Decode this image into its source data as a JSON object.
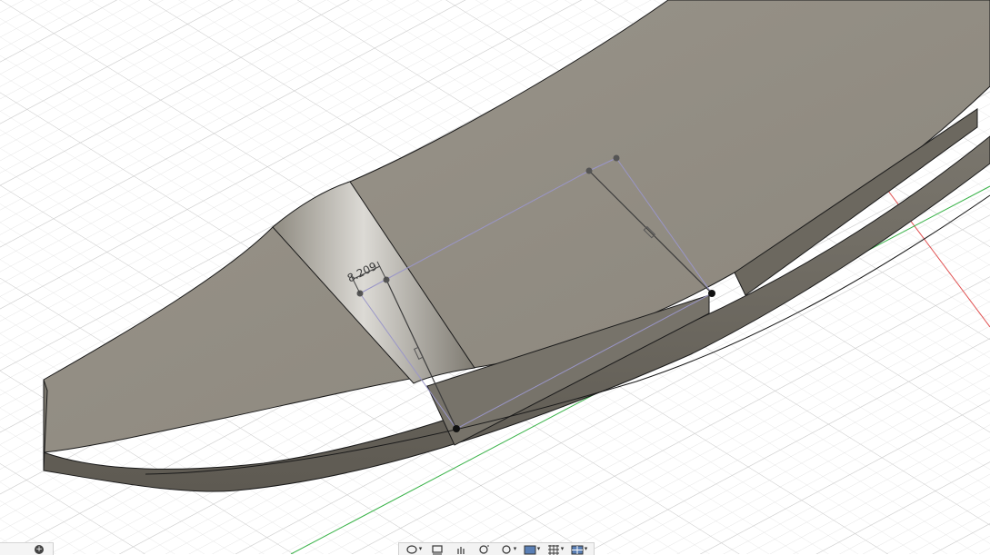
{
  "app": {
    "view": "3D model viewport"
  },
  "sketch": {
    "dimension_value": "8.209"
  },
  "toolbar": {
    "items": [
      {
        "icon": "orbit-icon",
        "has_menu": true
      },
      {
        "icon": "look-at-icon",
        "has_menu": false
      },
      {
        "icon": "pan-hand-icon",
        "has_menu": false
      },
      {
        "icon": "zoom-icon",
        "has_menu": false
      },
      {
        "icon": "fit-zoom-window-icon",
        "has_menu": true
      },
      {
        "icon": "display-settings-icon",
        "has_menu": true
      },
      {
        "icon": "grid-snap-icon",
        "has_menu": true
      },
      {
        "icon": "viewports-icon",
        "has_menu": true
      }
    ]
  },
  "colors": {
    "grid_major": "#cfcfcf",
    "grid_minor": "#e6e6e6",
    "body_top": "#8c877c",
    "body_side": "#6f6b62",
    "body_edge": "#1a1a1a",
    "axis_x_red": "#e05050",
    "axis_y_green": "#3bb34a",
    "sketch_line": "#9a96c8"
  }
}
